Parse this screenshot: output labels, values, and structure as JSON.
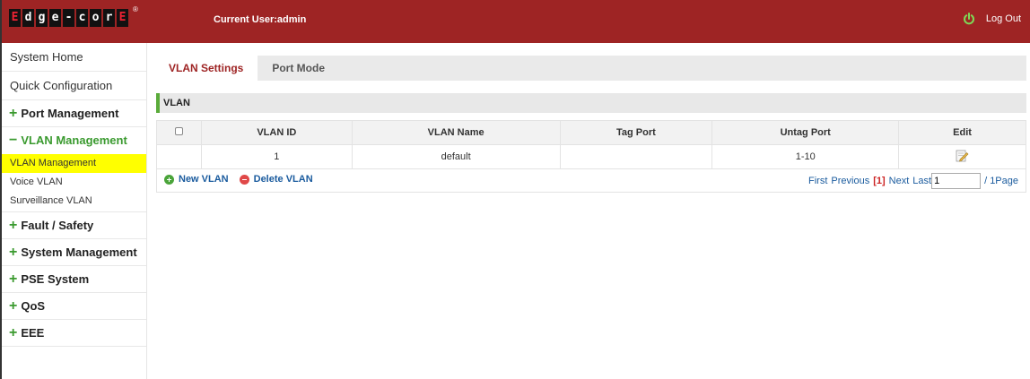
{
  "header": {
    "logo_chars": [
      "E",
      "d",
      "g",
      "e",
      "-",
      "c",
      "o",
      "r",
      "E"
    ],
    "logo_reg": "®",
    "current_user": "Current User:admin",
    "logout_label": "Log Out",
    "bg_color": "#9e2424"
  },
  "sidebar": {
    "system_home": "System Home",
    "quick_config": "Quick Configuration",
    "port_mgmt": "Port Management",
    "vlan_mgmt": "VLAN Management",
    "vlan_sub": [
      "VLAN Management",
      "Voice VLAN",
      "Surveillance VLAN"
    ],
    "fault_safety": "Fault / Safety",
    "system_mgmt": "System Management",
    "pse_system": "PSE System",
    "qos": "QoS",
    "eee": "EEE",
    "plus_symbol": "+",
    "minus_symbol": "−"
  },
  "tabs": [
    "VLAN Settings",
    "Port Mode"
  ],
  "section_title": "VLAN",
  "table": {
    "columns": [
      "VLAN ID",
      "VLAN Name",
      "Tag Port",
      "Untag Port",
      "Edit"
    ],
    "rows": [
      {
        "vlan_id": "1",
        "vlan_name": "default",
        "tag_port": "",
        "untag_port": "1-10"
      }
    ]
  },
  "actions": {
    "new_vlan": "New VLAN",
    "delete_vlan": "Delete VLAN"
  },
  "pager": {
    "first": "First",
    "previous": "Previous",
    "current": "[1]",
    "next": "Next",
    "last": "Last",
    "page_input_value": "1",
    "total": "/ 1Page"
  },
  "colors": {
    "accent_green": "#3a9a2f",
    "active_yellow": "#ffff00",
    "link_blue": "#1a5b9e"
  }
}
